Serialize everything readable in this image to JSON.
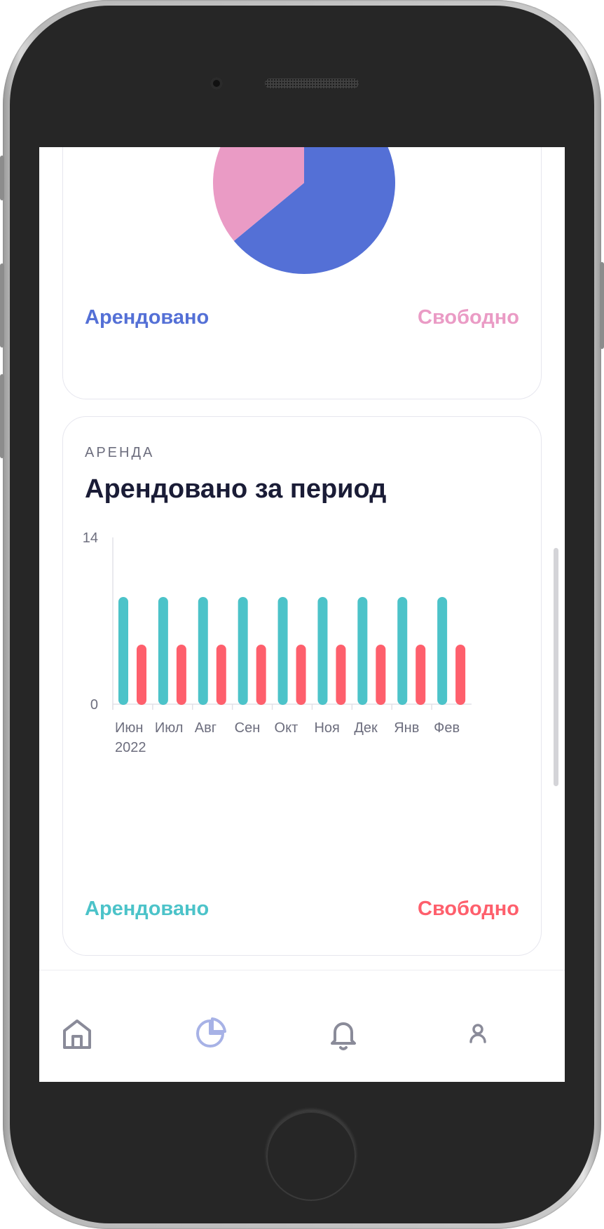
{
  "pie_legend": {
    "rented": "Арендовано",
    "free": "Свободно"
  },
  "pie_chart": {
    "type": "pie",
    "slices": [
      {
        "label": "Арендовано",
        "value": 64,
        "color": "#5470d6"
      },
      {
        "label": "Свободно",
        "value": 36,
        "color": "#ea9bc5"
      }
    ]
  },
  "rent_card": {
    "eyebrow": "АРЕНДА",
    "title": "Арендовано за период",
    "legend_rented": "Арендовано",
    "legend_free": "Свободно"
  },
  "chart_data": {
    "type": "bar",
    "categories": [
      "Июн",
      "Июл",
      "Авг",
      "Сен",
      "Окт",
      "Ноя",
      "Дек",
      "Янв",
      "Фев"
    ],
    "year_label": "2022",
    "ylim": [
      0,
      14
    ],
    "yticks": [
      "0",
      "14"
    ],
    "series": [
      {
        "name": "Арендовано",
        "color": "#4cc3c9",
        "values": [
          9,
          9,
          9,
          9,
          9,
          9,
          9,
          9,
          9
        ]
      },
      {
        "name": "Свободно",
        "color": "#fe5f6c",
        "values": [
          5,
          5,
          5,
          5,
          5,
          5,
          5,
          5,
          5
        ]
      }
    ]
  },
  "colors": {
    "rented_pie": "#5470d6",
    "free_pie": "#ea9bc5",
    "rented_bar": "#4cc3c9",
    "free_bar": "#fe5f6c",
    "tab_active": "#a7b2e6",
    "tab_inactive": "#8a8b99"
  },
  "tabbar": {
    "items": [
      {
        "icon": "home-icon",
        "active": false
      },
      {
        "icon": "pie-chart-icon",
        "active": true
      },
      {
        "icon": "bell-icon",
        "active": false
      },
      {
        "icon": "user-icon",
        "active": false
      }
    ]
  }
}
